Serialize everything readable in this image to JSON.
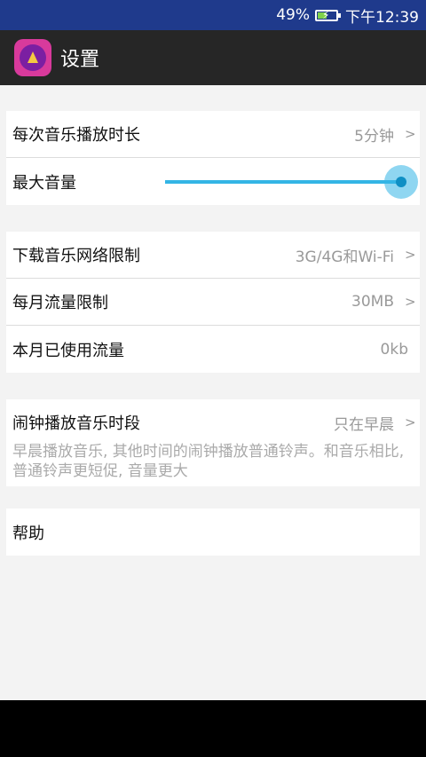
{
  "status_bar": {
    "battery_percent": "49%",
    "time": "下午12:39"
  },
  "app_bar": {
    "title": "设置",
    "icon": "music-app-icon"
  },
  "groups": {
    "playback": {
      "duration_label": "每次音乐播放时长",
      "duration_value": "5分钟",
      "max_volume_label": "最大音量",
      "max_volume_level": 1.0
    },
    "network": {
      "download_label": "下载音乐网络限制",
      "download_value": "3G/4G和Wi-Fi",
      "monthly_label": "每月流量限制",
      "monthly_value": "30MB",
      "used_label": "本月已使用流量",
      "used_value": "0kb"
    },
    "alarm": {
      "label": "闹钟播放音乐时段",
      "value": "只在早晨",
      "description": "早晨播放音乐, 其他时间的闹钟播放普通铃声。和音乐相比, 普通铃声更短促, 音量更大"
    },
    "help": {
      "label": "帮助"
    }
  },
  "chevron": ">",
  "colors": {
    "accent": "#33b5e5",
    "status_bar": "#1f3a8c",
    "app_bar": "#262626"
  }
}
